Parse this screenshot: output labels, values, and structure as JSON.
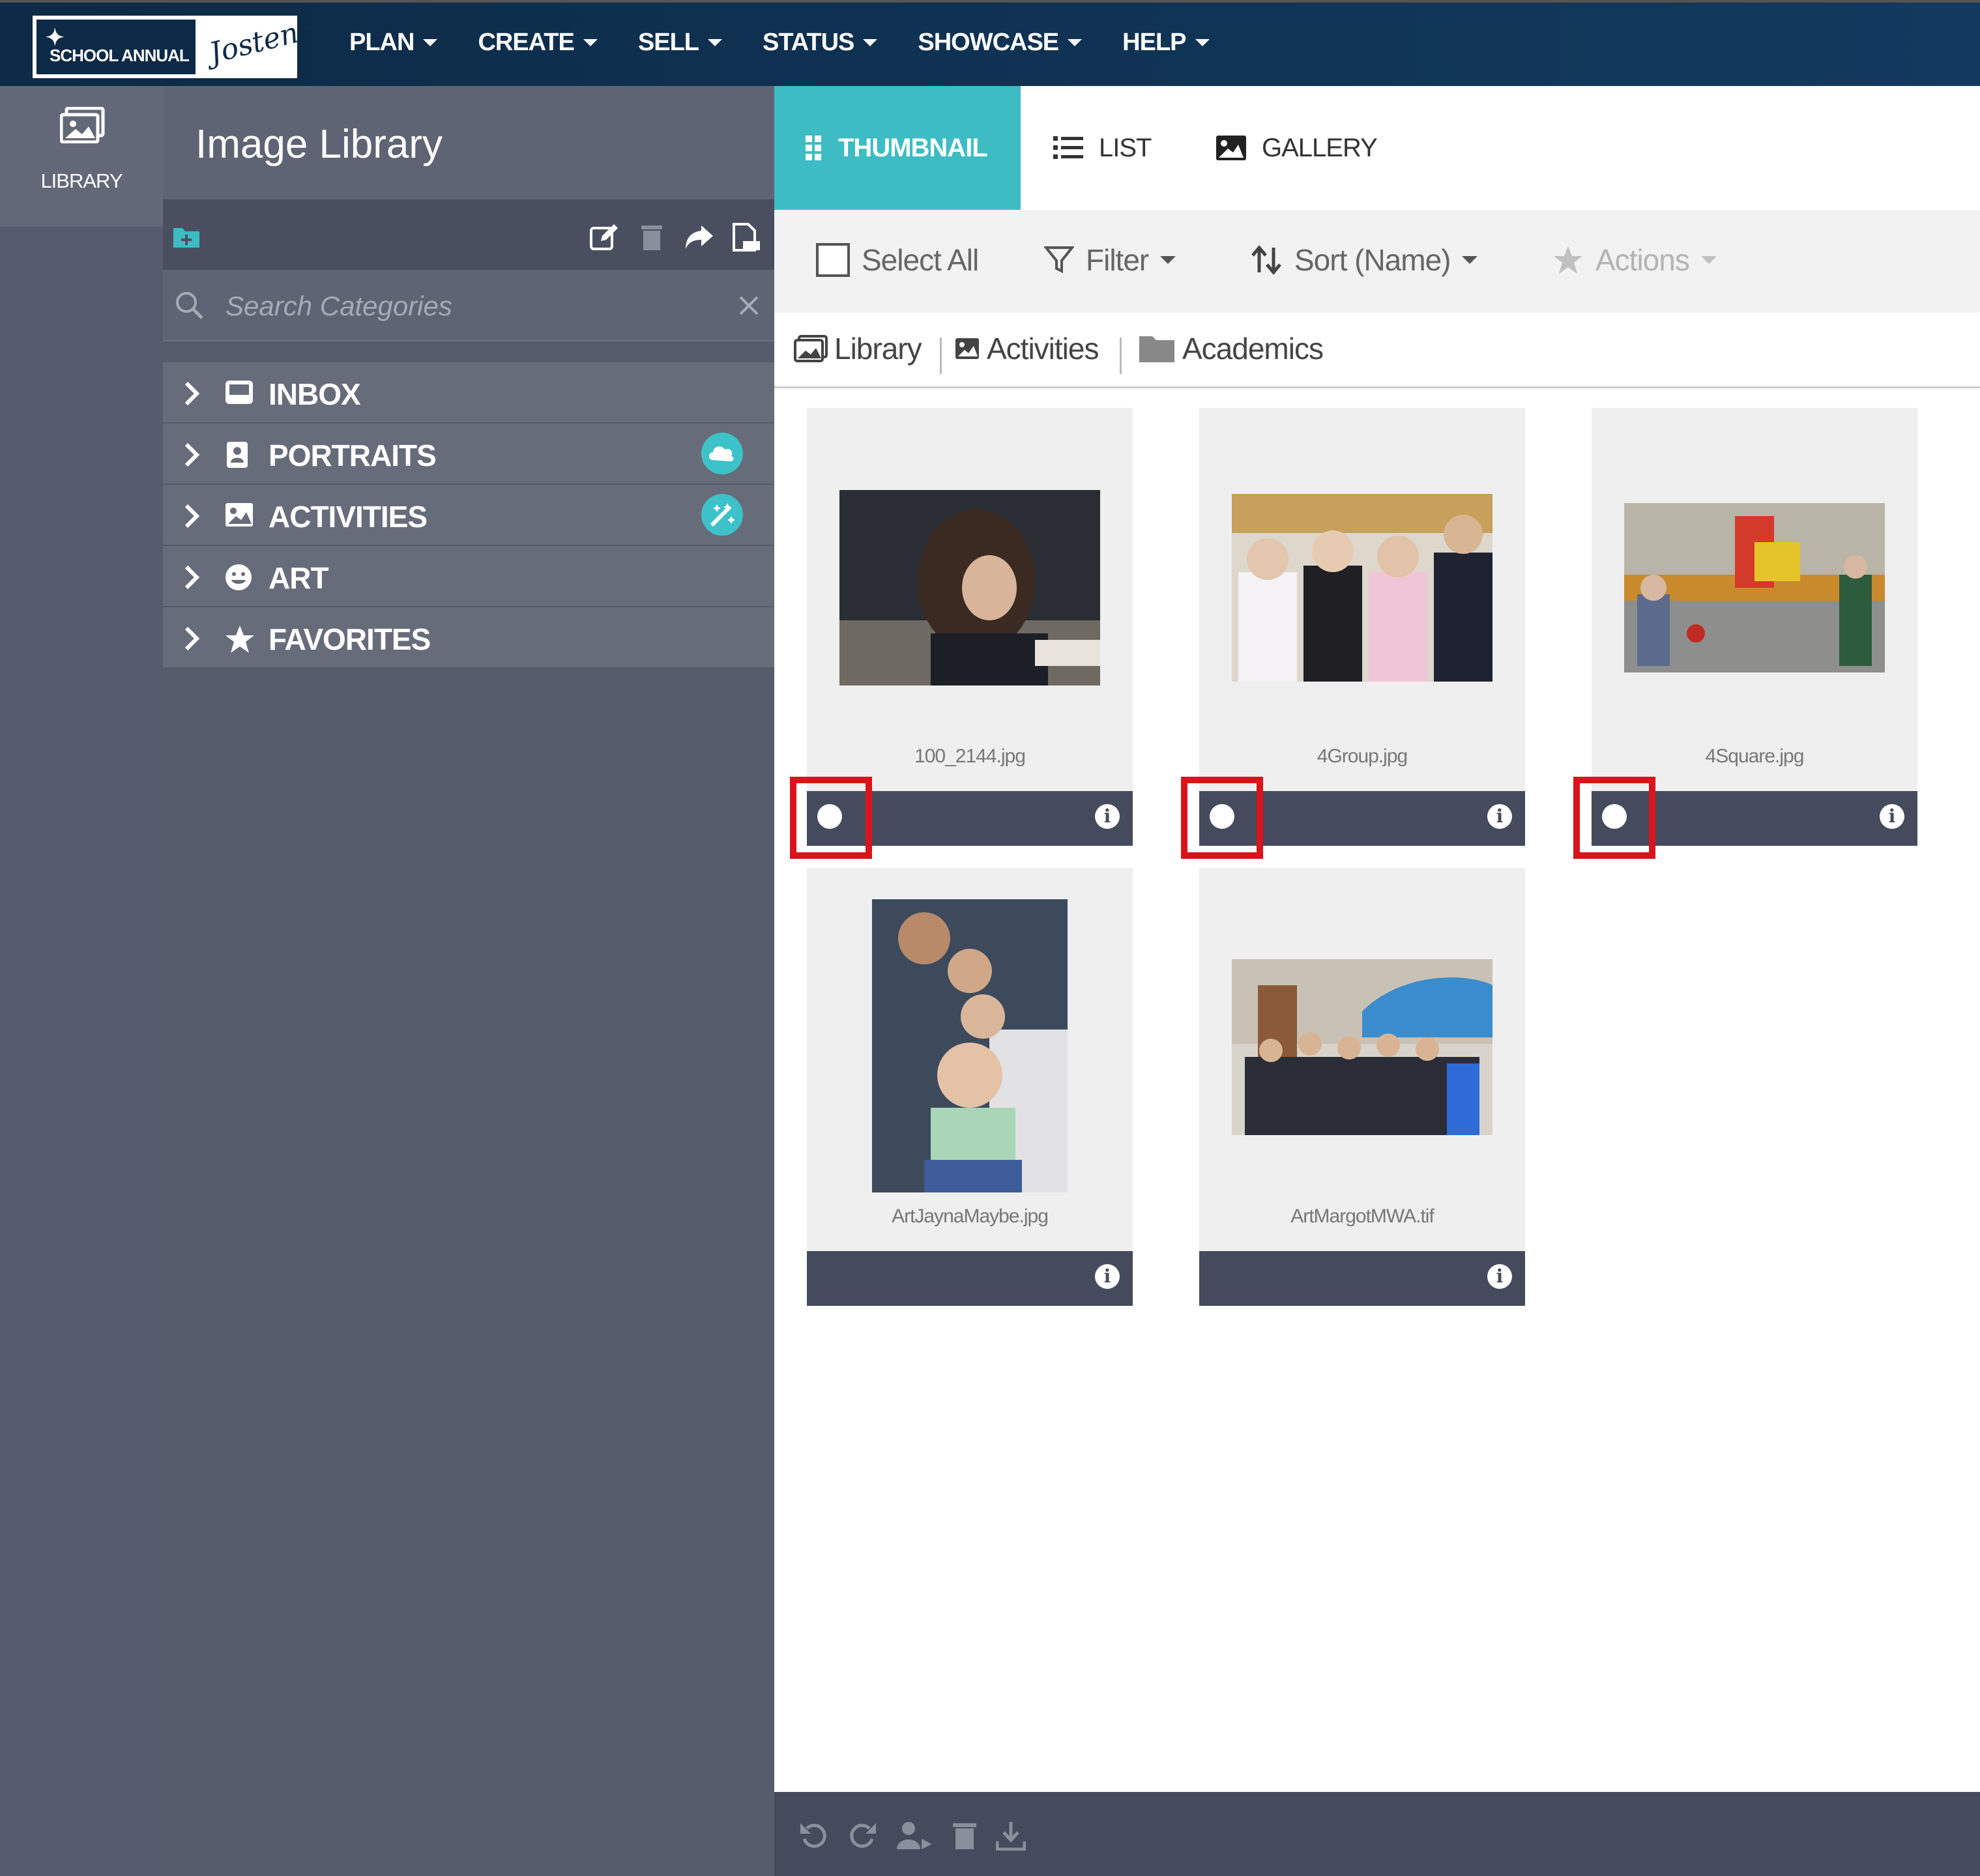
{
  "brand": {
    "left_text": "SCHOOL ANNUAL",
    "right_text": "Jostens"
  },
  "nav": [
    {
      "label": "PLAN"
    },
    {
      "label": "CREATE"
    },
    {
      "label": "SELL"
    },
    {
      "label": "STATUS"
    },
    {
      "label": "SHOWCASE"
    },
    {
      "label": "HELP"
    }
  ],
  "rail": {
    "label": "LIBRARY",
    "icon": "library-icon"
  },
  "panel": {
    "title": "Image Library",
    "search_placeholder": "Search Categories",
    "toolbar_icons": [
      "add-folder-icon",
      "edit-icon",
      "trash-icon",
      "share-icon",
      "pdf-icon"
    ],
    "categories": [
      {
        "label": "INBOX",
        "icon": "inbox-icon",
        "badge": null
      },
      {
        "label": "PORTRAITS",
        "icon": "portrait-icon",
        "badge": "cloud-icon"
      },
      {
        "label": "ACTIVITIES",
        "icon": "image-icon",
        "badge": "magic-wand-icon"
      },
      {
        "label": "ART",
        "icon": "smile-icon",
        "badge": null
      },
      {
        "label": "FAVORITES",
        "icon": "star-icon",
        "badge": null
      }
    ]
  },
  "views": {
    "thumbnail": "THUMBNAIL",
    "list": "LIST",
    "gallery": "GALLERY",
    "active": "thumbnail"
  },
  "toolbar": {
    "select_all": "Select All",
    "filter": "Filter",
    "sort": "Sort (Name)",
    "actions": "Actions"
  },
  "breadcrumb": [
    "Library",
    "Activities",
    "Academics"
  ],
  "images": [
    {
      "filename": "100_2144.jpg",
      "checked_highlight": true
    },
    {
      "filename": "4Group.jpg",
      "checked_highlight": true
    },
    {
      "filename": "4Square.jpg",
      "checked_highlight": true
    },
    {
      "filename": "ArtJaynaMaybe.jpg",
      "checked_highlight": false
    },
    {
      "filename": "ArtMargotMWA.tif",
      "checked_highlight": false
    }
  ],
  "bottom_icons": [
    "rotate-left-icon",
    "rotate-right-icon",
    "assign-person-icon",
    "trash-icon",
    "download-icon"
  ],
  "colors": {
    "nav_bg": "#0d2a47",
    "accent": "#3dbcc4",
    "highlight": "#d8141c",
    "panel_bg": "#575c6d"
  }
}
